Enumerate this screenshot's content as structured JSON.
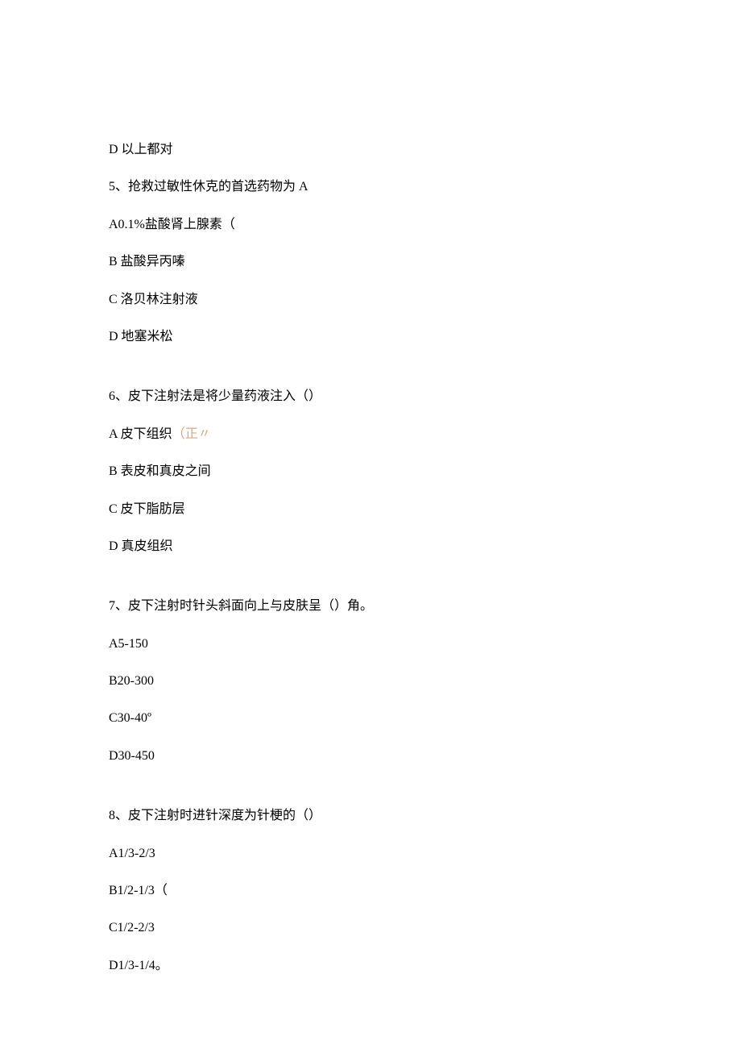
{
  "q4": {
    "d": "D 以上都对"
  },
  "q5": {
    "stem": "5、抢救过敏性休克的首选药物为 A",
    "a": "A0.1%盐酸肾上腺素（",
    "b": "B 盐酸异丙嗪",
    "c": "C 洛贝林注射液",
    "d": "D 地塞米松"
  },
  "q6": {
    "stem": "6、皮下注射法是将少量药液注入（）",
    "a": "A 皮下组织",
    "a_marker": "（正〃",
    "b": "B 表皮和真皮之间",
    "c": "C 皮下脂肪层",
    "d": "D 真皮组织"
  },
  "q7": {
    "stem": "7、皮下注射时针头斜面向上与皮肤呈（）角。",
    "a": "A5-150",
    "b": "B20-300",
    "c": "C30-40º",
    "d": "D30-450"
  },
  "q8": {
    "stem": "8、皮下注射时进针深度为针梗的（）",
    "a": "A1/3-2/3",
    "b": "B1/2-1/3（",
    "c": "C1/2-2/3",
    "d": "D1/3-1/4。"
  }
}
